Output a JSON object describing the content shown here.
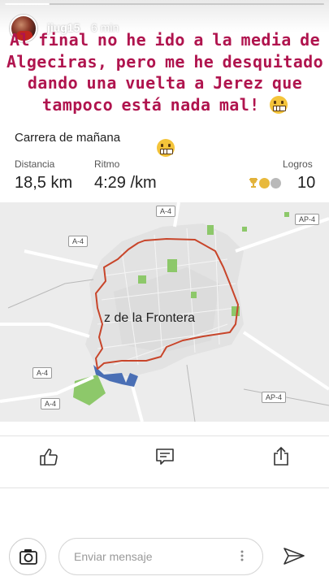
{
  "story": {
    "progress": 0.14
  },
  "header": {
    "username": "jiug15",
    "time_ago": "6 min"
  },
  "caption": {
    "text": "Al final no he ido a la media de Algeciras, pero me he desquitado dando una vuelta a Jerez que tampoco está nada mal!",
    "emoji": "grimacing-face"
  },
  "activity": {
    "title": "Carrera de mañana",
    "stats": [
      {
        "label": "Distancia",
        "value": "18,5 km"
      },
      {
        "label": "Ritmo",
        "value": "4:29 /km"
      }
    ],
    "achievements": {
      "label": "Logros",
      "count": "10"
    }
  },
  "map": {
    "city_label": "z de la Frontera",
    "roads": [
      "A-4",
      "A-4",
      "A-4",
      "A-4",
      "AP-4",
      "AP-4"
    ],
    "route_color": "#c8452a",
    "water_color": "#4a6fb5",
    "park_color": "#8dc86a"
  },
  "actions": {
    "like_icon": "thumbs-up-icon",
    "comment_icon": "comment-icon",
    "share_icon": "share-icon"
  },
  "reply": {
    "placeholder": "Enviar mensaje"
  },
  "colors": {
    "caption": "#b0144e"
  }
}
